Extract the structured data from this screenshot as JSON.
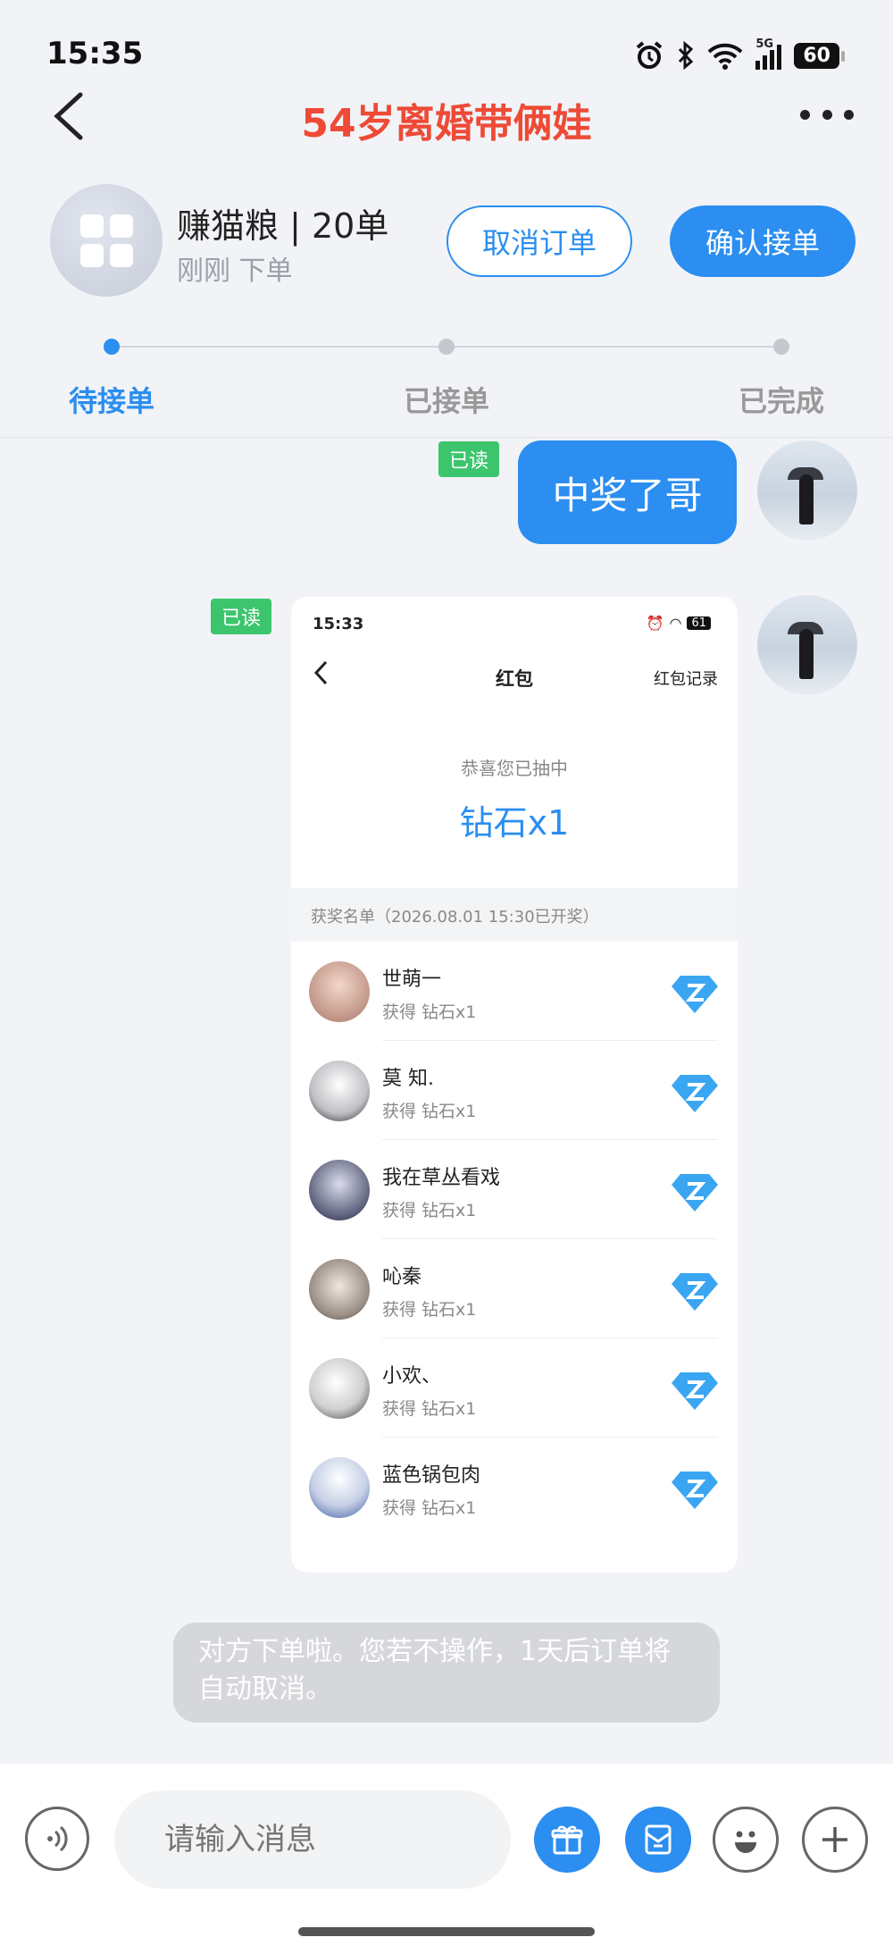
{
  "status_bar": {
    "time": "15:35",
    "network": "5G",
    "battery": "60"
  },
  "header": {
    "title": "54岁离婚带俩娃"
  },
  "order": {
    "name": "赚猫粮 | 20单",
    "time": "刚刚 下单",
    "cancel_label": "取消订单",
    "confirm_label": "确认接单"
  },
  "progress": {
    "steps": [
      "待接单",
      "已接单",
      "已完成"
    ],
    "current_step": 0
  },
  "chat": {
    "messages": [
      {
        "read": "已读",
        "text": "中奖了哥"
      },
      {
        "read": "已读"
      }
    ],
    "screenshot": {
      "time": "15:33",
      "battery": "61",
      "title": "红包",
      "record": "红包记录",
      "congrats": "恭喜您已抽中",
      "prize": "钻石x1",
      "list_header": "获奖名单（2026.08.01 15:30已开奖）",
      "winners": [
        {
          "name": "世萌一",
          "reward": "获得 钻石x1"
        },
        {
          "name": "莫 知.",
          "reward": "获得 钻石x1"
        },
        {
          "name": "我在草丛看戏",
          "reward": "获得 钻石x1"
        },
        {
          "name": "吣秦",
          "reward": "获得 钻石x1"
        },
        {
          "name": "小欢、",
          "reward": "获得 钻石x1"
        },
        {
          "name": "蓝色锅包肉",
          "reward": "获得 钻石x1"
        }
      ]
    },
    "notice": "对方下单啦。您若不操作，1天后订单将自动取消。"
  },
  "input": {
    "placeholder": "请输入消息"
  },
  "colors": {
    "accent": "#2b8ef0",
    "title": "#ee4a36",
    "read_badge": "#3cc56d"
  },
  "icons": [
    "voice-icon",
    "gift-icon",
    "red-packet-icon",
    "emoji-icon",
    "plus-icon"
  ]
}
